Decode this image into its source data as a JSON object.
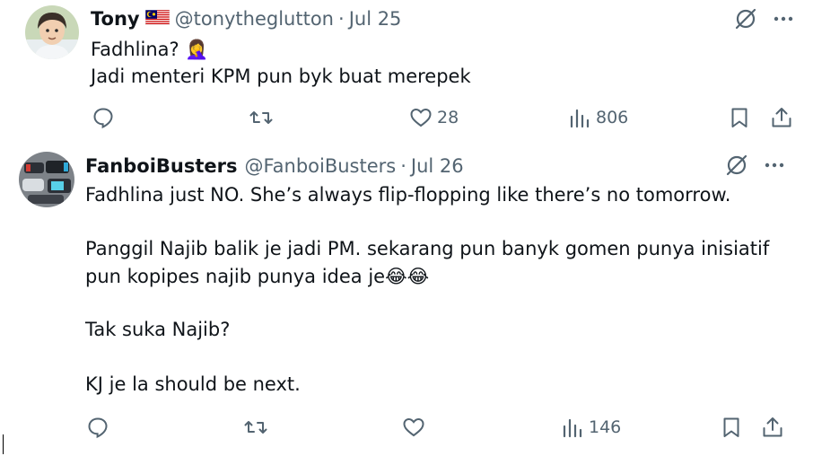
{
  "tweets": [
    {
      "name": "Tony",
      "handle": "@tonytheglutton",
      "separator": "·",
      "date": "Jul 25",
      "lines": [
        "Fadhlina? 🤦‍♀️",
        "Jadi menteri KPM pun byk buat merepek"
      ],
      "actions": {
        "replies": "",
        "retweets": "",
        "likes": "28",
        "views": "806"
      }
    },
    {
      "name": "FanboiBusters",
      "handle": "@FanboiBusters",
      "separator": "·",
      "date": "Jul 26",
      "lines": [
        "Fadhlina just NO. She’s always flip-flopping like there’s no tomorrow.",
        "Panggil Najib balik je jadi PM. sekarang pun banyk gomen punya inisiatif",
        "pun kopipes najib punya idea je😂😂",
        "Tak suka Najib?",
        "KJ je la should be next."
      ],
      "actions": {
        "replies": "",
        "retweets": "",
        "likes": "",
        "views": "146"
      }
    }
  ],
  "colors": {
    "text": "#0f1419",
    "muted": "#536471",
    "flag_red": "#cc0001",
    "flag_blue": "#010066",
    "flag_yellow": "#ffcc00"
  },
  "icons": [
    "reply-icon",
    "retweet-icon",
    "like-icon",
    "views-icon",
    "bookmark-icon",
    "share-icon",
    "grok-icon",
    "more-icon"
  ]
}
